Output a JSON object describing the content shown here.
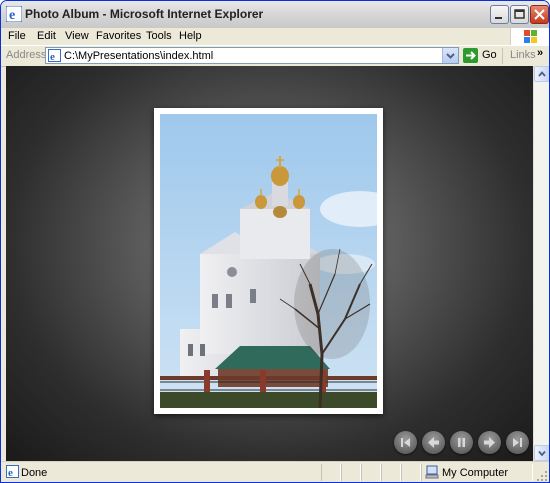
{
  "window": {
    "title": "Photo Album - Microsoft Internet Explorer"
  },
  "menu": {
    "file": "File",
    "edit": "Edit",
    "view": "View",
    "favorites": "Favorites",
    "tools": "Tools",
    "help": "Help"
  },
  "address": {
    "label": "Address",
    "url": "C:\\MyPresentations\\index.html",
    "go_label": "Go",
    "links_label": "Links"
  },
  "slideshow": {
    "photo_subject": "church photo",
    "controls": [
      "first-icon",
      "previous-icon",
      "pause-icon",
      "next-icon",
      "last-icon"
    ]
  },
  "status": {
    "text": "Done",
    "zone": "My Computer"
  },
  "colors": {
    "titlebar": "#d7d7d7",
    "background": "#2e2e2e",
    "frame": "#ffffff",
    "close": "#c43a1b"
  }
}
